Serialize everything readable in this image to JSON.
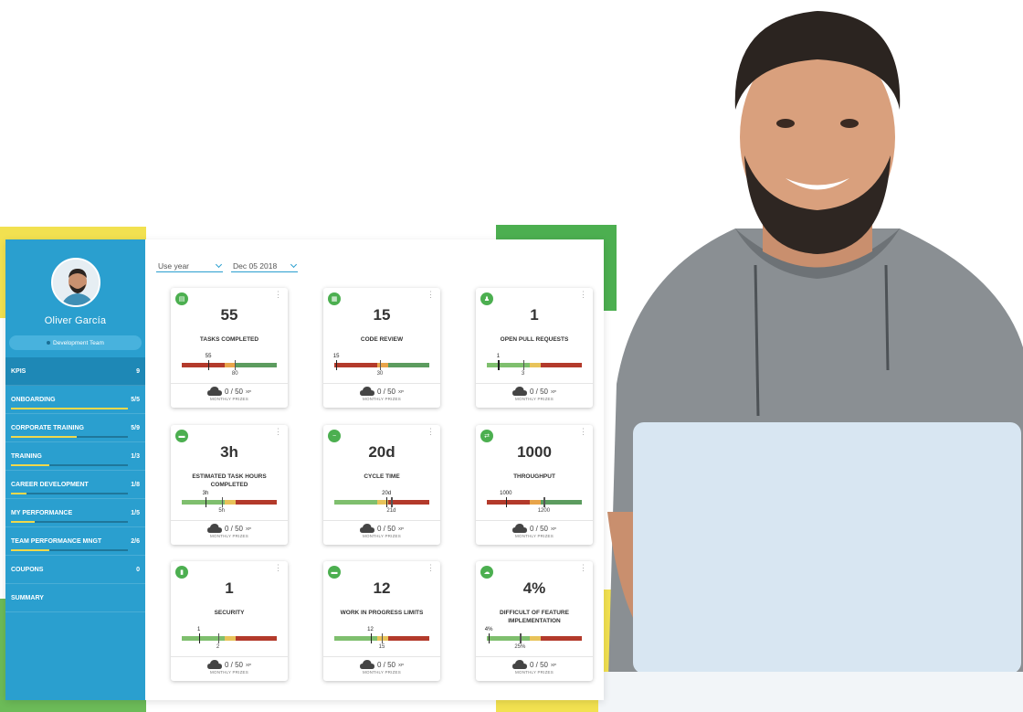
{
  "user": {
    "name": "Oliver García",
    "team": "Development Team"
  },
  "sidebar": {
    "items": [
      {
        "label": "KPIS",
        "count": "9",
        "progress": 0,
        "active": true
      },
      {
        "label": "ONBOARDING",
        "count": "5/5",
        "progress": 1.0
      },
      {
        "label": "CORPORATE TRAINING",
        "count": "5/9",
        "progress": 0.56
      },
      {
        "label": "TRAINING",
        "count": "1/3",
        "progress": 0.33
      },
      {
        "label": "CAREER DEVELOPMENT",
        "count": "1/8",
        "progress": 0.13
      },
      {
        "label": "MY PERFORMANCE",
        "count": "1/5",
        "progress": 0.2
      },
      {
        "label": "TEAM PERFORMANCE MNGT",
        "count": "2/6",
        "progress": 0.33
      },
      {
        "label": "COUPONS",
        "count": "0",
        "progress": 0
      },
      {
        "label": "SUMMARY",
        "count": "",
        "progress": 0
      }
    ]
  },
  "filters": {
    "period": "Use year",
    "date": "Dec 05 2018"
  },
  "xp_text": "0 / 50",
  "xp_unit": "XP",
  "prize_label": "MONTHLY PRIZES",
  "kpis": [
    {
      "value": "55",
      "label": "TASKS COMPLETED",
      "icon": "document-icon",
      "current": "55",
      "target": "80",
      "scale": "red-to-green",
      "cur_pos": 0.28,
      "tgt_pos": 0.56
    },
    {
      "value": "15",
      "label": "CODE REVIEW",
      "icon": "clipboard-icon",
      "current": "15",
      "target": "30",
      "scale": "red-to-green",
      "cur_pos": 0.02,
      "tgt_pos": 0.48
    },
    {
      "value": "1",
      "label": "OPEN PULL REQUESTS",
      "icon": "person-icon",
      "current": "1",
      "target": "3",
      "scale": "green-to-red",
      "cur_pos": 0.12,
      "tgt_pos": 0.38
    },
    {
      "value": "3h",
      "label": "ESTIMATED TASK HOURS COMPLETED",
      "icon": "truck-icon",
      "current": "3h",
      "target": "5h",
      "scale": "green-to-red",
      "cur_pos": 0.25,
      "tgt_pos": 0.42
    },
    {
      "value": "20d",
      "label": "CYCLE TIME",
      "icon": "minus-icon",
      "current": "20d",
      "target": "21d",
      "scale": "green-to-red",
      "cur_pos": 0.55,
      "tgt_pos": 0.6
    },
    {
      "value": "1000",
      "label": "THROUGHPUT",
      "icon": "flow-icon",
      "current": "1000",
      "target": "1200",
      "scale": "red-to-green",
      "cur_pos": 0.2,
      "tgt_pos": 0.6
    },
    {
      "value": "1",
      "label": "SECURITY",
      "icon": "book-icon",
      "current": "1",
      "target": "2",
      "scale": "green-to-red",
      "cur_pos": 0.18,
      "tgt_pos": 0.38
    },
    {
      "value": "12",
      "label": "WORK IN PROGRESS LIMITS",
      "icon": "truck-icon",
      "current": "12",
      "target": "15",
      "scale": "green-to-red",
      "cur_pos": 0.38,
      "tgt_pos": 0.5
    },
    {
      "value": "4%",
      "label": "DIFFICULT OF FEATURE IMPLEMENTATION",
      "icon": "cloud-upload-icon",
      "current": "4%",
      "target": "25%",
      "scale": "green-to-red",
      "cur_pos": 0.02,
      "tgt_pos": 0.35
    }
  ],
  "colors": {
    "sidebar": "#2a9fcf",
    "green": "#4caf50",
    "yellow": "#f2e150",
    "red": "#c0392b",
    "orange": "#e8a44a"
  }
}
